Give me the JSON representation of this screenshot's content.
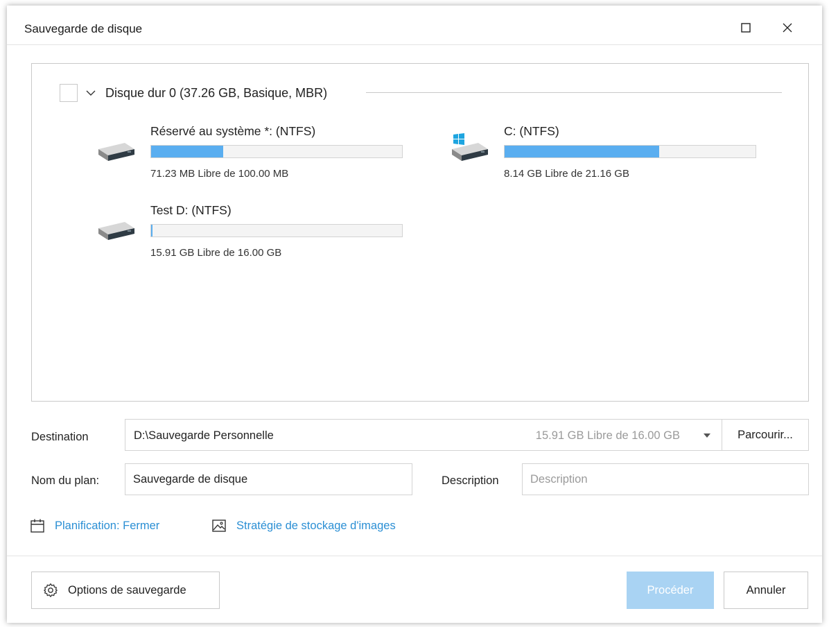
{
  "window": {
    "title": "Sauvegarde de disque"
  },
  "disk": {
    "header": "Disque dur 0 (37.26 GB, Basique, MBR)",
    "checked": false,
    "partitions": [
      {
        "name": "Réservé au système *: (NTFS)",
        "free_text": "71.23 MB Libre de 100.00 MB",
        "used_fraction": 0.288,
        "icon": "hard-drive-icon"
      },
      {
        "name": "C: (NTFS)",
        "free_text": "8.14 GB Libre de 21.16 GB",
        "used_fraction": 0.615,
        "icon": "windows-drive-icon"
      },
      {
        "name": "Test D: (NTFS)",
        "free_text": "15.91 GB Libre de 16.00 GB",
        "used_fraction": 0.0056,
        "icon": "hard-drive-icon"
      }
    ]
  },
  "destination": {
    "label": "Destination",
    "path": "D:\\Sauvegarde Personnelle",
    "free_text": "15.91 GB Libre de 16.00 GB",
    "browse_label": "Parcourir..."
  },
  "plan": {
    "label": "Nom du plan:",
    "value": "Sauvegarde de disque"
  },
  "description": {
    "label": "Description",
    "placeholder": "Description"
  },
  "links": {
    "schedule": "Planification: Fermer",
    "image_storage": "Stratégie de stockage d'images"
  },
  "footer": {
    "options_label": "Options de sauvegarde",
    "proceed_label": "Procéder",
    "cancel_label": "Annuler"
  },
  "colors": {
    "accent": "#2b8fd4",
    "bar_fill": "#5aaef0",
    "proceed_disabled": "#a9d3f3"
  }
}
